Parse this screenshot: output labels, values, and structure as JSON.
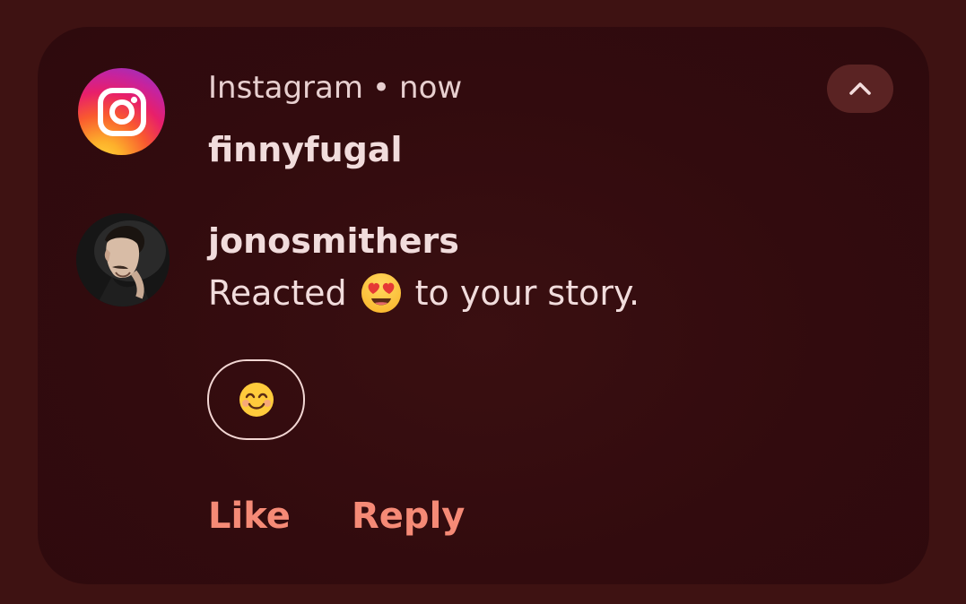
{
  "notification": {
    "app_name": "Instagram",
    "separator": "•",
    "time": "now",
    "title": "finnyfugal",
    "app_icon": "instagram-logo",
    "collapse_icon": "chevron-up-icon"
  },
  "message": {
    "sender": "jonosmithers",
    "text_before": "Reacted",
    "reaction_emoji": "😍",
    "text_after": "to your story.",
    "avatar": "user-avatar-photo"
  },
  "quick_reply": {
    "emoji": "😊"
  },
  "actions": {
    "like_label": "Like",
    "reply_label": "Reply"
  },
  "colors": {
    "background": "#3e1212",
    "card": "#320b0e",
    "text": "#f1dcdc",
    "action_accent": "#f58a76",
    "collapse_button": "#5a2323"
  }
}
